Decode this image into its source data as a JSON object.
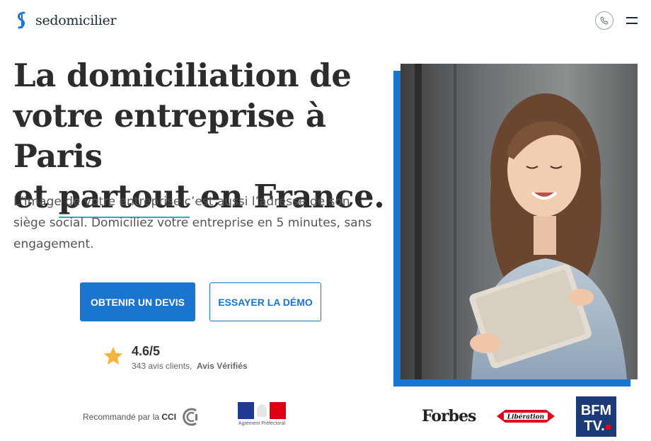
{
  "header": {
    "brand": "sedomicilier",
    "phone_icon": "phone-icon",
    "menu_icon": "hamburger-menu-icon"
  },
  "hero": {
    "title_line1": "La domiciliation de",
    "title_line2": "votre entreprise à Paris",
    "title_prefix": "et ",
    "title_highlight": "partout",
    "title_suffix": " en France.",
    "subtitle": "L’image de votre entreprise c’est aussi l’adresse de son siège social. Domiciliez votre entreprise en 5 minutes, sans engagement."
  },
  "cta": {
    "primary_label": "OBTENIR UN DEVIS",
    "secondary_label": "ESSAYER LA DÉMO"
  },
  "rating": {
    "score": "4.6/5",
    "count": "343 avis clients,",
    "source": "Avis Vérifiés"
  },
  "trust": {
    "cci_prefix": "Recommandé par la ",
    "cci_name": "CCI",
    "prefectoral_label": "Agrément Préfectoral"
  },
  "press": {
    "forbes": "Forbes",
    "liberation": "Libération",
    "bfm_top": "BFM",
    "bfm_bottom": "TV."
  },
  "colors": {
    "brand_blue": "#1a75d1",
    "accent_teal": "#2bb3a6",
    "star_gold": "#f5b53f"
  }
}
